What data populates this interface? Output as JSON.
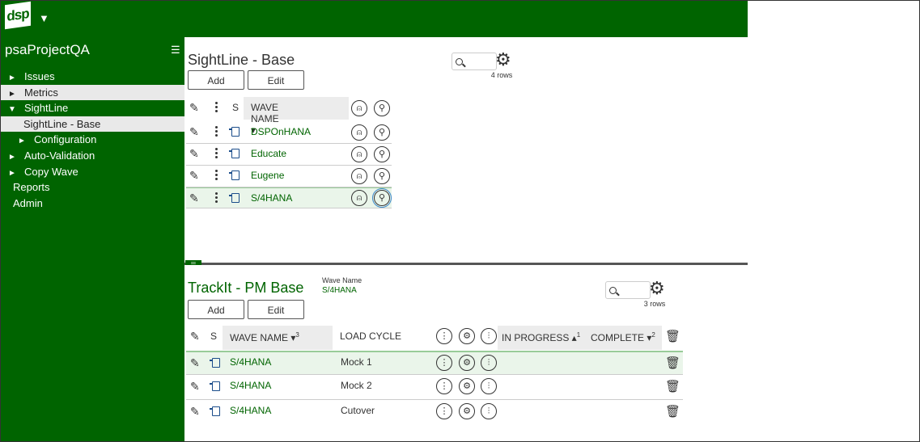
{
  "app": {
    "logo_text": "dsp",
    "logo_caret": "▼"
  },
  "sidebar": {
    "project_name": "psaProjectQA",
    "menu_icon": "☰",
    "items": [
      {
        "label": "Issues",
        "arrow": "►"
      },
      {
        "label": "Metrics",
        "arrow": "►"
      },
      {
        "label": "SightLine",
        "arrow": "▼"
      },
      {
        "label": "SightLine - Base"
      },
      {
        "label": "Configuration",
        "arrow": "►"
      },
      {
        "label": "Auto-Validation",
        "arrow": "►"
      },
      {
        "label": "Copy Wave",
        "arrow": "►"
      },
      {
        "label": "Reports"
      },
      {
        "label": "Admin"
      }
    ]
  },
  "sightline": {
    "title": "SightLine - Base",
    "add_label": "Add",
    "edit_label": "Edit",
    "row_count": "4 rows",
    "header": {
      "s": "S",
      "wave_name": "WAVE NAME ▾"
    },
    "rows": [
      "DSPOnHANA",
      "Educate",
      "Eugene",
      "S/4HANA"
    ]
  },
  "trackit": {
    "title": "TrackIt - PM Base",
    "wave_name_label": "Wave Name",
    "wave_name_value": "S/4HANA",
    "add_label": "Add",
    "edit_label": "Edit",
    "row_count": "3 rows",
    "header": {
      "s": "S",
      "wave_name": "WAVE NAME ▾",
      "wave_name_sort": "3",
      "load_cycle": "LOAD CYCLE",
      "in_progress": "IN PROGRESS ▴",
      "in_progress_sort": "1",
      "complete": "COMPLETE ▾",
      "complete_sort": "2"
    },
    "rows": [
      {
        "wave": "S/4HANA",
        "cycle": "Mock 1"
      },
      {
        "wave": "S/4HANA",
        "cycle": "Mock 2"
      },
      {
        "wave": "S/4HANA",
        "cycle": "Cutover"
      }
    ]
  },
  "colors": {
    "brand_green": "#006400",
    "selected_row": "#eaf5ea",
    "focus_blue": "#3a87c8"
  }
}
